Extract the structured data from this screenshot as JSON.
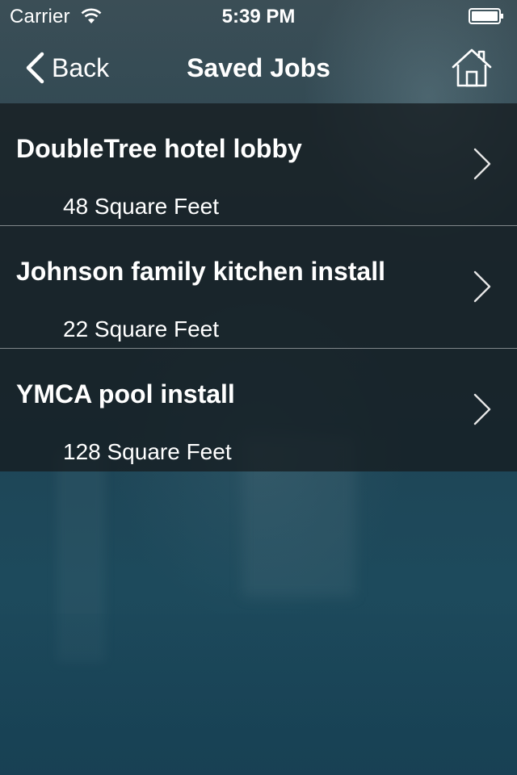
{
  "status_bar": {
    "carrier": "Carrier",
    "time": "5:39 PM",
    "icons": [
      "wifi-icon",
      "battery-icon"
    ]
  },
  "nav": {
    "back_label": "Back",
    "title": "Saved Jobs",
    "home_icon": "home-icon"
  },
  "jobs": [
    {
      "title": "DoubleTree hotel lobby",
      "size": "48 Square Feet"
    },
    {
      "title": "Johnson family kitchen install",
      "size": "22 Square Feet"
    },
    {
      "title": "YMCA pool install",
      "size": "128 Square Feet"
    }
  ],
  "colors": {
    "text": "#ffffff",
    "list_background": "#161c20",
    "background": "#1d3844"
  }
}
